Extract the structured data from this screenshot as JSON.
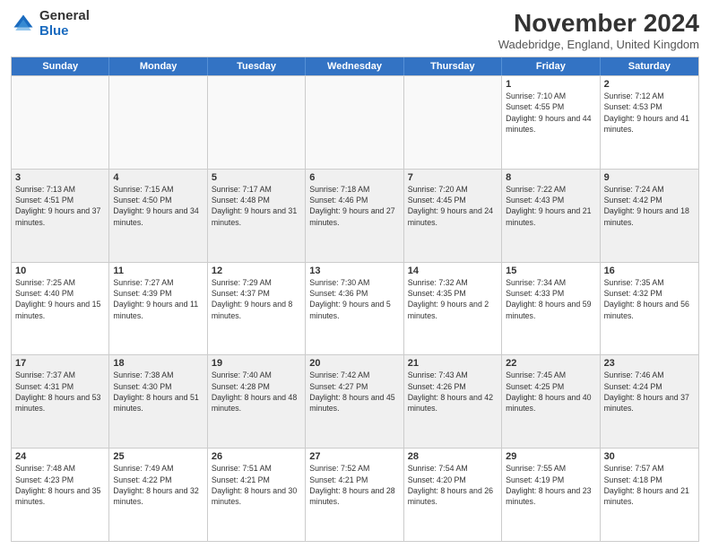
{
  "logo": {
    "general": "General",
    "blue": "Blue"
  },
  "title": "November 2024",
  "location": "Wadebridge, England, United Kingdom",
  "headers": [
    "Sunday",
    "Monday",
    "Tuesday",
    "Wednesday",
    "Thursday",
    "Friday",
    "Saturday"
  ],
  "rows": [
    [
      {
        "day": "",
        "info": "",
        "empty": true
      },
      {
        "day": "",
        "info": "",
        "empty": true
      },
      {
        "day": "",
        "info": "",
        "empty": true
      },
      {
        "day": "",
        "info": "",
        "empty": true
      },
      {
        "day": "",
        "info": "",
        "empty": true
      },
      {
        "day": "1",
        "info": "Sunrise: 7:10 AM\nSunset: 4:55 PM\nDaylight: 9 hours and 44 minutes."
      },
      {
        "day": "2",
        "info": "Sunrise: 7:12 AM\nSunset: 4:53 PM\nDaylight: 9 hours and 41 minutes."
      }
    ],
    [
      {
        "day": "3",
        "info": "Sunrise: 7:13 AM\nSunset: 4:51 PM\nDaylight: 9 hours and 37 minutes.",
        "shaded": true
      },
      {
        "day": "4",
        "info": "Sunrise: 7:15 AM\nSunset: 4:50 PM\nDaylight: 9 hours and 34 minutes.",
        "shaded": true
      },
      {
        "day": "5",
        "info": "Sunrise: 7:17 AM\nSunset: 4:48 PM\nDaylight: 9 hours and 31 minutes.",
        "shaded": true
      },
      {
        "day": "6",
        "info": "Sunrise: 7:18 AM\nSunset: 4:46 PM\nDaylight: 9 hours and 27 minutes.",
        "shaded": true
      },
      {
        "day": "7",
        "info": "Sunrise: 7:20 AM\nSunset: 4:45 PM\nDaylight: 9 hours and 24 minutes.",
        "shaded": true
      },
      {
        "day": "8",
        "info": "Sunrise: 7:22 AM\nSunset: 4:43 PM\nDaylight: 9 hours and 21 minutes.",
        "shaded": true
      },
      {
        "day": "9",
        "info": "Sunrise: 7:24 AM\nSunset: 4:42 PM\nDaylight: 9 hours and 18 minutes.",
        "shaded": true
      }
    ],
    [
      {
        "day": "10",
        "info": "Sunrise: 7:25 AM\nSunset: 4:40 PM\nDaylight: 9 hours and 15 minutes."
      },
      {
        "day": "11",
        "info": "Sunrise: 7:27 AM\nSunset: 4:39 PM\nDaylight: 9 hours and 11 minutes."
      },
      {
        "day": "12",
        "info": "Sunrise: 7:29 AM\nSunset: 4:37 PM\nDaylight: 9 hours and 8 minutes."
      },
      {
        "day": "13",
        "info": "Sunrise: 7:30 AM\nSunset: 4:36 PM\nDaylight: 9 hours and 5 minutes."
      },
      {
        "day": "14",
        "info": "Sunrise: 7:32 AM\nSunset: 4:35 PM\nDaylight: 9 hours and 2 minutes."
      },
      {
        "day": "15",
        "info": "Sunrise: 7:34 AM\nSunset: 4:33 PM\nDaylight: 8 hours and 59 minutes."
      },
      {
        "day": "16",
        "info": "Sunrise: 7:35 AM\nSunset: 4:32 PM\nDaylight: 8 hours and 56 minutes."
      }
    ],
    [
      {
        "day": "17",
        "info": "Sunrise: 7:37 AM\nSunset: 4:31 PM\nDaylight: 8 hours and 53 minutes.",
        "shaded": true
      },
      {
        "day": "18",
        "info": "Sunrise: 7:38 AM\nSunset: 4:30 PM\nDaylight: 8 hours and 51 minutes.",
        "shaded": true
      },
      {
        "day": "19",
        "info": "Sunrise: 7:40 AM\nSunset: 4:28 PM\nDaylight: 8 hours and 48 minutes.",
        "shaded": true
      },
      {
        "day": "20",
        "info": "Sunrise: 7:42 AM\nSunset: 4:27 PM\nDaylight: 8 hours and 45 minutes.",
        "shaded": true
      },
      {
        "day": "21",
        "info": "Sunrise: 7:43 AM\nSunset: 4:26 PM\nDaylight: 8 hours and 42 minutes.",
        "shaded": true
      },
      {
        "day": "22",
        "info": "Sunrise: 7:45 AM\nSunset: 4:25 PM\nDaylight: 8 hours and 40 minutes.",
        "shaded": true
      },
      {
        "day": "23",
        "info": "Sunrise: 7:46 AM\nSunset: 4:24 PM\nDaylight: 8 hours and 37 minutes.",
        "shaded": true
      }
    ],
    [
      {
        "day": "24",
        "info": "Sunrise: 7:48 AM\nSunset: 4:23 PM\nDaylight: 8 hours and 35 minutes."
      },
      {
        "day": "25",
        "info": "Sunrise: 7:49 AM\nSunset: 4:22 PM\nDaylight: 8 hours and 32 minutes."
      },
      {
        "day": "26",
        "info": "Sunrise: 7:51 AM\nSunset: 4:21 PM\nDaylight: 8 hours and 30 minutes."
      },
      {
        "day": "27",
        "info": "Sunrise: 7:52 AM\nSunset: 4:21 PM\nDaylight: 8 hours and 28 minutes."
      },
      {
        "day": "28",
        "info": "Sunrise: 7:54 AM\nSunset: 4:20 PM\nDaylight: 8 hours and 26 minutes."
      },
      {
        "day": "29",
        "info": "Sunrise: 7:55 AM\nSunset: 4:19 PM\nDaylight: 8 hours and 23 minutes."
      },
      {
        "day": "30",
        "info": "Sunrise: 7:57 AM\nSunset: 4:18 PM\nDaylight: 8 hours and 21 minutes."
      }
    ]
  ]
}
